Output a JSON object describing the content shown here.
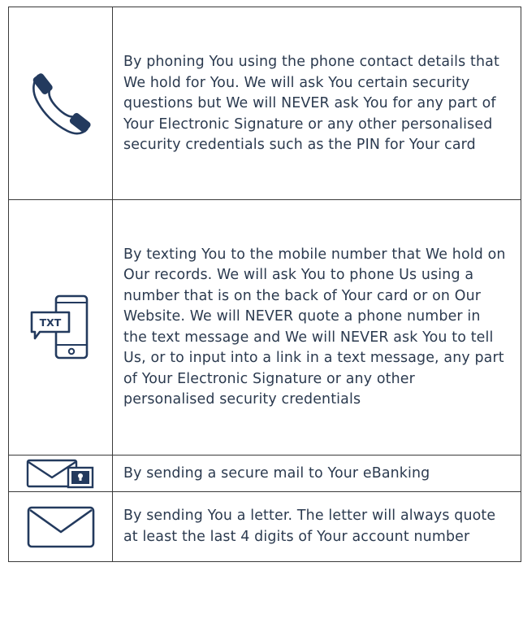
{
  "rows": [
    {
      "icon": "phone-icon",
      "text": "By phoning You using the phone contact details that We hold for You. We will ask You certain security questions but We will NEVER ask You for any part of Your Electronic Signature or any other personalised security credentials such as the PIN for Your card"
    },
    {
      "icon": "mobile-text-message-icon",
      "icon_label": "TXT",
      "text": "By texting You to the mobile number that We hold on Our records. We will ask You to phone Us using a number that is on the back of Your card or on Our Website. We will NEVER quote a phone number in the text message and We will NEVER ask You to tell Us, or to input into a link in a text message, any part of Your Electronic Signature or any other personalised security credentials"
    },
    {
      "icon": "secure-mail-icon",
      "text": "By sending a secure mail to Your eBanking"
    },
    {
      "icon": "letter-envelope-icon",
      "text": "By sending You a letter. The letter will always quote at least the last 4 digits of Your account number"
    }
  ],
  "colors": {
    "icon_navy": "#233a5e",
    "text": "#2b3a4f",
    "border": "#3a3a3a"
  }
}
